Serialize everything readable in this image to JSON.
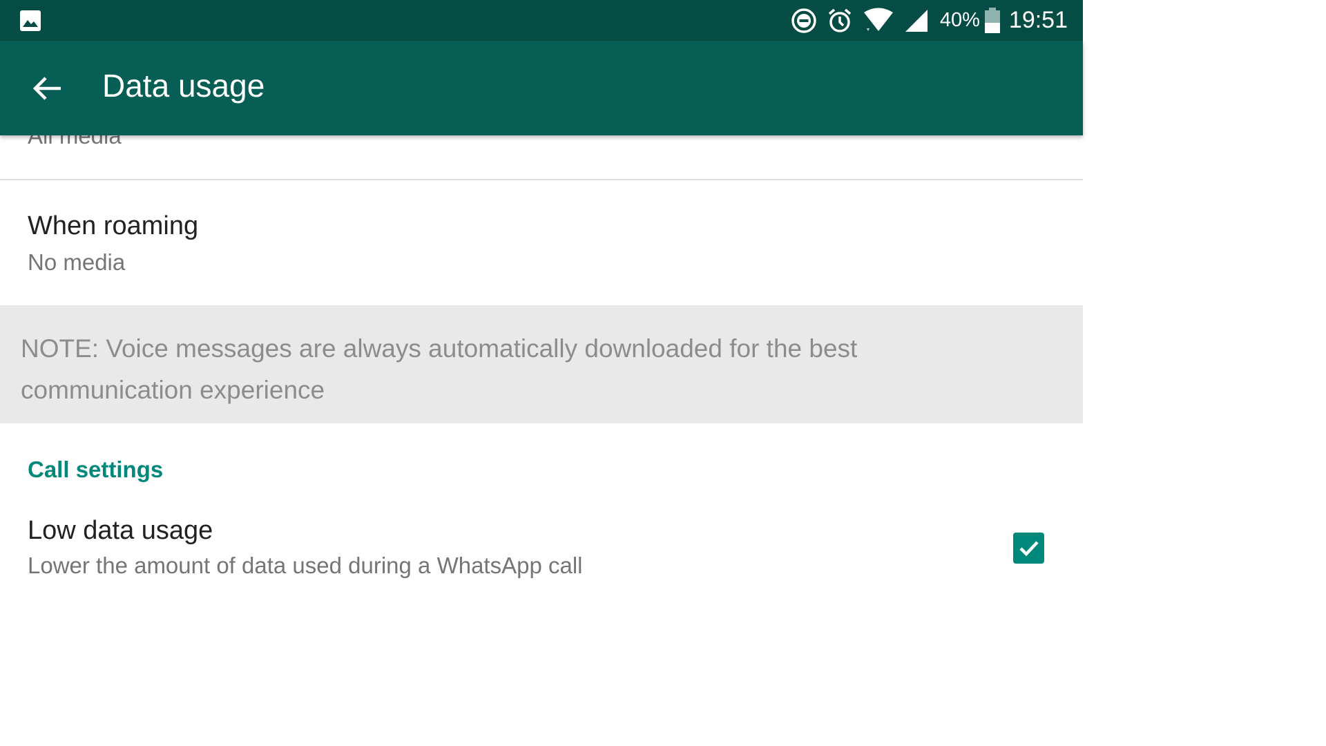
{
  "status_bar": {
    "left_icon": "image-notification-icon",
    "icons": [
      "do-not-disturb-icon",
      "alarm-icon",
      "wifi-icon",
      "cell-signal-icon"
    ],
    "battery_percent": "40%",
    "time": "19:51"
  },
  "app_bar": {
    "title": "Data usage",
    "back_icon": "arrow-back-icon",
    "color": "#075e54"
  },
  "settings": {
    "previous_item_subtitle": "All media",
    "roaming": {
      "title": "When roaming",
      "subtitle": "No media"
    },
    "note": "NOTE: Voice messages are always automatically downloaded for the best communication experience",
    "call_settings": {
      "header": "Call settings",
      "low_data_usage": {
        "title": "Low data usage",
        "subtitle": "Lower the amount of data used during a WhatsApp call",
        "checked": true
      }
    }
  },
  "colors": {
    "status_bar": "#054d44",
    "accent": "#00897b"
  }
}
